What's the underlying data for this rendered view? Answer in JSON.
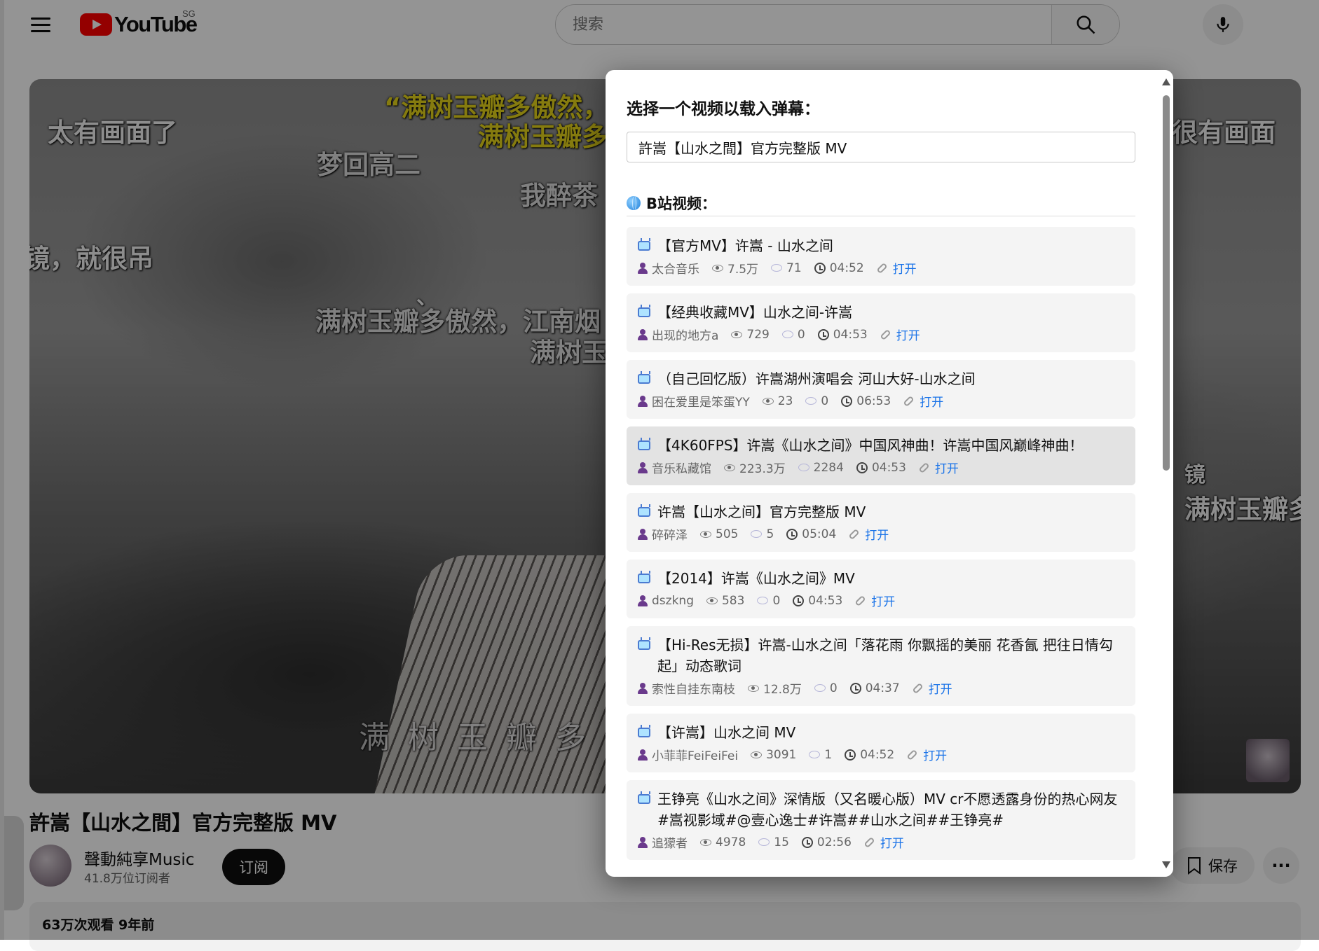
{
  "header": {
    "logo_text": "YouTube",
    "region": "SG",
    "search_placeholder": "搜索",
    "icons": {
      "menu": "hamburger-icon",
      "search": "search-icon",
      "mic": "mic-icon"
    }
  },
  "video": {
    "danmaku": [
      "太有画面了",
      "“满树玉瓣多傲然，",
      "满树玉瓣多",
      "梦回高二",
      "我醉茶",
      "镜，就很吊",
      "、",
      "满树玉瓣多傲然，江南烟",
      "满树玉",
      "很有画面",
      "满树玉瓣多",
      "镜",
      "满 树 玉 瓣 多 傲"
    ]
  },
  "below": {
    "title": "許嵩【山水之間】官方完整版 MV",
    "channel_name": "聲動純享Music",
    "subscribers": "41.8万位订阅者",
    "subscribe_label": "订阅",
    "save_label": "保存",
    "more_label": "···",
    "stats": "63万次观看  9年前"
  },
  "modal": {
    "title": "选择一个视频以载入弹幕：",
    "search_value": "許嵩【山水之間】官方完整版 MV",
    "section_label": "B站视频：",
    "open_label": "打开",
    "items": [
      {
        "title": "【官方MV】许嵩 - 山水之间",
        "uploader": "太合音乐",
        "views": "7.5万",
        "comments": "71",
        "duration": "04:52"
      },
      {
        "title": "【经典收藏MV】山水之间-许嵩",
        "uploader": "出现的地方a",
        "views": "729",
        "comments": "0",
        "duration": "04:53"
      },
      {
        "title": "（自己回忆版）许嵩湖州演唱会 河山大好-山水之间",
        "uploader": "困在爱里是笨蛋YY",
        "views": "23",
        "comments": "0",
        "duration": "06:53"
      },
      {
        "title": "【4K60FPS】许嵩《山水之间》中国风神曲！许嵩中国风巅峰神曲！",
        "uploader": "音乐私藏馆",
        "views": "223.3万",
        "comments": "2284",
        "duration": "04:53"
      },
      {
        "title": "许嵩【山水之间】官方完整版 MV",
        "uploader": "碎碎泽",
        "views": "505",
        "comments": "5",
        "duration": "05:04"
      },
      {
        "title": "【2014】许嵩《山水之间》MV",
        "uploader": "dszkng",
        "views": "583",
        "comments": "0",
        "duration": "04:53"
      },
      {
        "title": "【Hi-Res无损】许嵩-山水之间「落花雨 你飘摇的美丽 花香氤 把往日情勾起」动态歌词",
        "uploader": "索性自挂东南枝",
        "views": "12.8万",
        "comments": "0",
        "duration": "04:37"
      },
      {
        "title": "【许嵩】山水之间 MV",
        "uploader": "小菲菲FeiFeiFei",
        "views": "3091",
        "comments": "1",
        "duration": "04:52"
      },
      {
        "title": "王铮亮《山水之间》深情版（又名暖心版）MV cr不愿透露身份的热心网友 #嵩视影域#@壹心逸士#许嵩##山水之间##王铮亮#",
        "uploader": "追獴者",
        "views": "4978",
        "comments": "15",
        "duration": "02:56"
      }
    ]
  }
}
